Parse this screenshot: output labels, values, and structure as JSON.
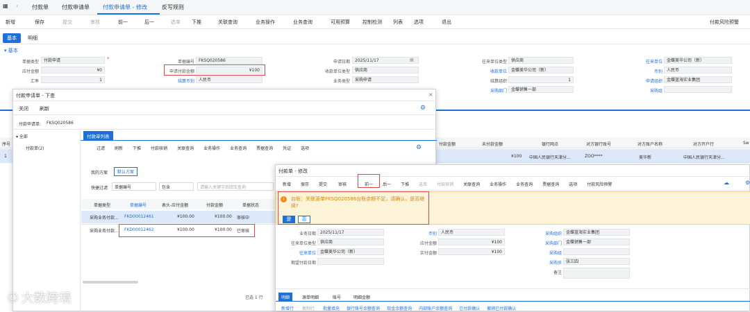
{
  "tabs": [
    "付款单",
    "付款申请单",
    "付款申请单 - 修改",
    "反写规则"
  ],
  "toolbar": {
    "items": [
      "新增",
      "保存",
      "提交",
      "审核",
      "前一",
      "后一",
      "选单",
      "下推",
      "关联查询",
      "业务操作",
      "业务查询",
      "可用预算",
      "控制检测",
      "列表",
      "选项",
      "退出"
    ],
    "right": "付款风险预警"
  },
  "subtabs": [
    "基本",
    "明细"
  ],
  "section": "基本",
  "form": {
    "l1": "单据类型",
    "v1": "付款申请",
    "l2": "应付金额",
    "v2": "¥0",
    "l3": "汇率",
    "v3": "1",
    "l4": "单据编号",
    "v4": "FKSQ020586",
    "l5": "申请付款金额",
    "v5": "¥100",
    "l6": "结算币别",
    "v6": "人民币",
    "l7": "申请日期",
    "v7": "2025/11/17",
    "l8": "收款单位类型",
    "v8": "供应商",
    "l9": "业务类型",
    "v9": "采购申请",
    "l10": "往来单位类型",
    "v10": "供应商",
    "l11": "收款单位",
    "v11": "金蝶美华公司（新）",
    "l12": "结算组织",
    "v12": "1",
    "l13": "采购部门",
    "v13": "金蝶销售一部",
    "l14": "往来单位",
    "v14": "金蝶美华公司（新）",
    "l15": "币别",
    "v15": "人民币",
    "l16": "申请组织",
    "v16": "金蝶蓝海实业集团",
    "l17": "采购组"
  },
  "bg_grid": {
    "headers": [
      "序号",
      "付款金额",
      "未付款金额",
      "银行网点",
      "对方银行账号",
      "对方账户名称",
      "对方开户行",
      "Sw"
    ],
    "row": [
      "1",
      "¥100",
      "中国人民银行天津分...",
      "ZOO****",
      "美华新",
      "中国人民银行天津分..."
    ]
  },
  "dlg1": {
    "title": "付款申请单 - 下查",
    "actions": [
      "关闭",
      "刷新"
    ],
    "doc_label": "付款申请单:",
    "doc_no": "FKSQ020586",
    "tree": [
      "全部",
      "付款单(2)"
    ],
    "list_tab": "付款单列表",
    "toolbar": [
      "过滤",
      "刷新",
      "下推",
      "付款核销",
      "关联查询",
      "业务操作",
      "业务查询",
      "票据查询",
      "凭证",
      "选项"
    ],
    "scheme_label": "我的方案",
    "scheme": "默认方案",
    "filter_label": "快捷过滤",
    "filter_field": "单据编号",
    "filter_op": "包含",
    "filter_placeholder": "请输入关键字后回车查询",
    "headers": [
      "单据类型",
      "单据编号",
      "表头-应付金额",
      "付款金额",
      "单据状态"
    ],
    "rows": [
      [
        "采购业务付款...",
        "FKD00012461",
        "¥100.00",
        "¥100.00",
        "审核中"
      ],
      [
        "采购业务付款...",
        "FKD00012462",
        "¥100.00",
        "¥100.00",
        "已审核"
      ]
    ],
    "footer": "已选 1 行"
  },
  "dlg2": {
    "title": "付款单 - 修改",
    "toolbar": [
      "新增",
      "保存",
      "提交",
      "审核",
      "前一",
      "后一",
      "下推",
      "选单",
      "付款核销",
      "关联查询",
      "业务操作",
      "业务查询",
      "票据查询",
      "选项",
      "付款风险预警"
    ],
    "warning": "台账：关联源单FKSQ020586台账余额不足，请确认，是否继续?",
    "btn_yes": "是",
    "btn_no": "否",
    "f1l": "业务日期",
    "f1v": "2025/11/17",
    "f2l": "往来单位类型",
    "f2v": "供应商",
    "f3l": "往来单位",
    "f3v": "金蝶美华公司（新）",
    "f4l": "期望付款日期",
    "f5l": "币别",
    "f5v": "人民币",
    "f6l": "应付金额",
    "f6v": "¥100",
    "f7l": "实付金额",
    "f7v": "¥100",
    "f8l": "采购组织",
    "f8v": "金蝶蓝海实业集团",
    "f9l": "采购部门",
    "f9v": "金蝶销售一部",
    "f10l": "采购组",
    "f11l": "采购员",
    "f11v": "张三四",
    "f12l": "备注",
    "btabs": [
      "明细",
      "源单明细",
      "账号",
      "明细金额"
    ],
    "bactions": [
      "新增行",
      "复制行",
      "批量填充",
      "银行账号余额查询",
      "现金余额查询",
      "内部账户余额查询",
      "已付款确认",
      "撤销已付款确认"
    ]
  },
  "watermark": "大数跨境"
}
